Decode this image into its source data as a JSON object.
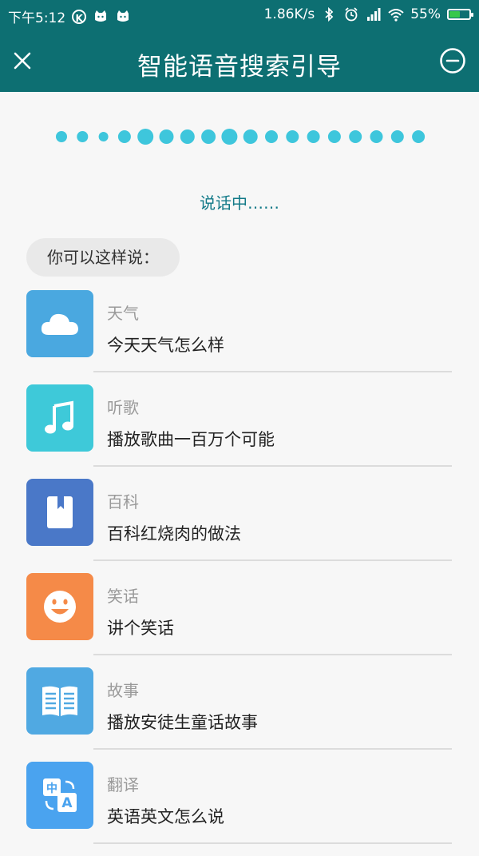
{
  "status_bar": {
    "time": "下午5:12",
    "speed": "1.86K/s",
    "battery": "55%",
    "battery_level": 0.55
  },
  "header": {
    "title": "智能语音搜索引导"
  },
  "listening": {
    "status": "说话中……"
  },
  "hint": {
    "label": "你可以这样说："
  },
  "colors": {
    "header_bg": "#0d6f72",
    "accent_text": "#127a88",
    "wave_dot": "#3ec6dc"
  },
  "suggestions": [
    {
      "category": "天气",
      "example": "今天天气怎么样",
      "icon": "cloud-icon",
      "color": "#4aa8e0"
    },
    {
      "category": "听歌",
      "example": "播放歌曲一百万个可能",
      "icon": "music-note-icon",
      "color": "#3ec9d9"
    },
    {
      "category": "百科",
      "example": "百科红烧肉的做法",
      "icon": "bookmark-book-icon",
      "color": "#4a78c8"
    },
    {
      "category": "笑话",
      "example": "讲个笑话",
      "icon": "smiley-face-icon",
      "color": "#f58a48"
    },
    {
      "category": "故事",
      "example": "播放安徒生童话故事",
      "icon": "open-book-icon",
      "color": "#50a9e2"
    },
    {
      "category": "翻译",
      "example": "英语英文怎么说",
      "icon": "translate-icon",
      "color": "#4aa3ef"
    }
  ]
}
